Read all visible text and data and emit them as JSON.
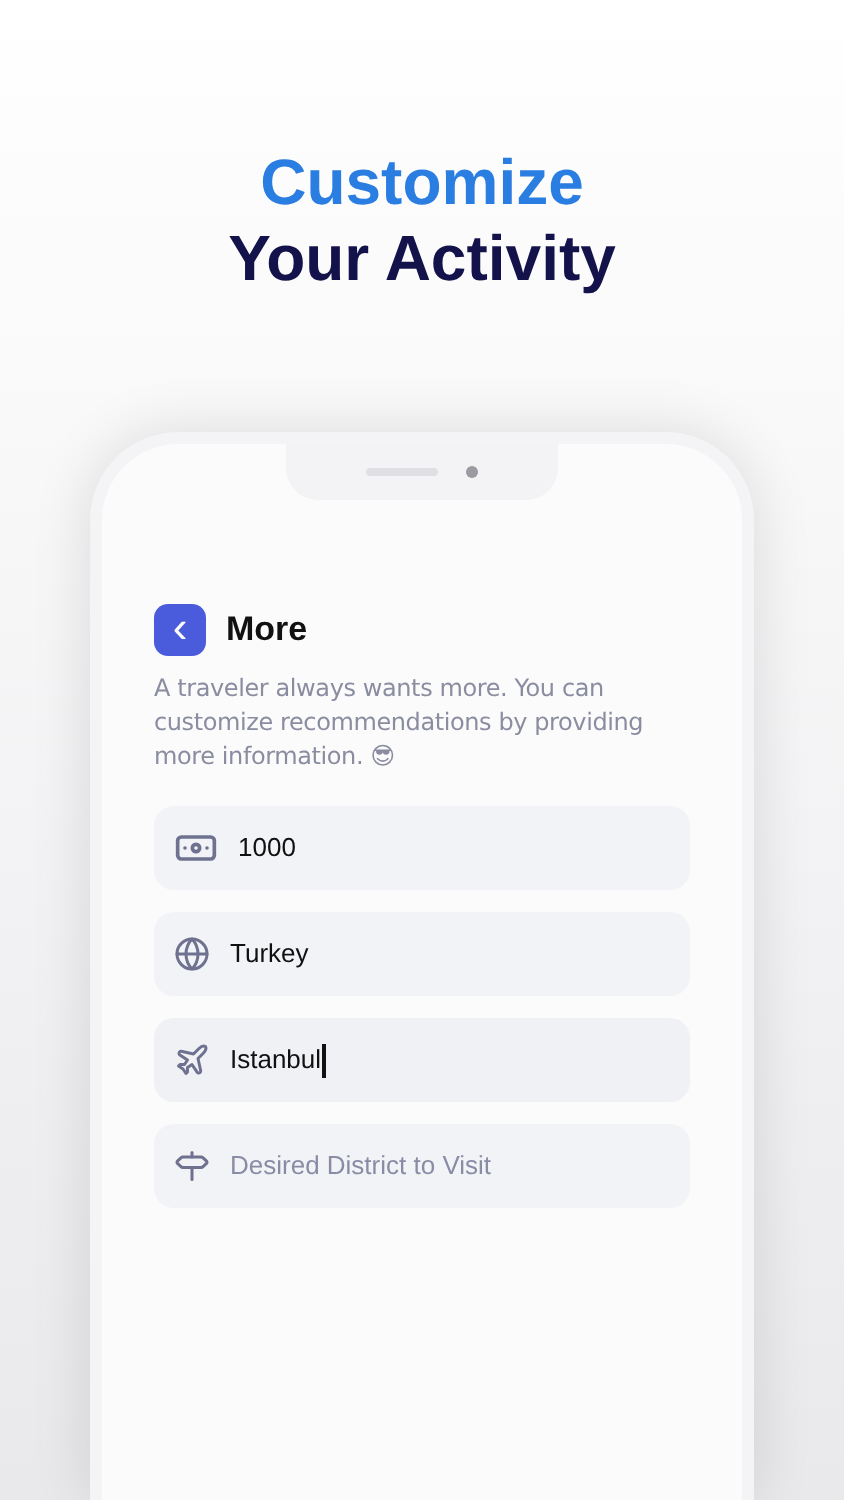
{
  "headline": {
    "line_1": "Customize",
    "line_2": "Your Activity"
  },
  "screen": {
    "back_button": "‹",
    "title": "More",
    "description": "A traveler always wants more. You can customize recommendations by providing more information. 😎",
    "fields": [
      {
        "kind": "money",
        "value": "1000",
        "focused": false
      },
      {
        "kind": "globe",
        "value": "Turkey",
        "focused": false
      },
      {
        "kind": "plane",
        "value": "Istanbul",
        "focused": true
      },
      {
        "kind": "signpost",
        "placeholder": "Desired District to Visit",
        "focused": false
      }
    ]
  }
}
